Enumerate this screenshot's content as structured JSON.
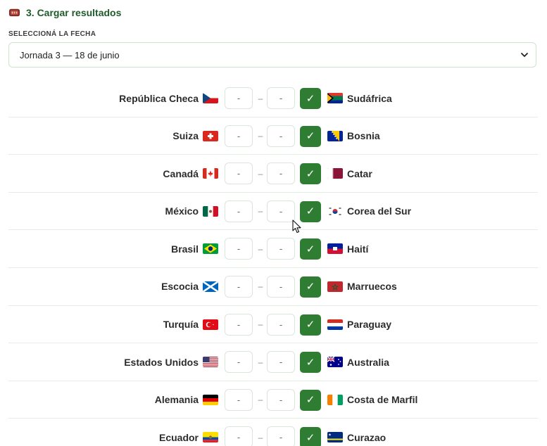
{
  "section": {
    "title": "3. Cargar resultados",
    "icon": "gamepad-icon"
  },
  "date_picker": {
    "label": "SELECCIONÁ LA FECHA",
    "selected": "Jornada 3 — 18 de junio"
  },
  "matches": [
    {
      "home": "República Checa",
      "home_flag": "cz",
      "away": "Sudáfrica",
      "away_flag": "za",
      "home_score": "-",
      "away_score": "-",
      "separator": "–"
    },
    {
      "home": "Suiza",
      "home_flag": "ch",
      "away": "Bosnia",
      "away_flag": "ba",
      "home_score": "-",
      "away_score": "-",
      "separator": "–"
    },
    {
      "home": "Canadá",
      "home_flag": "ca",
      "away": "Catar",
      "away_flag": "qa",
      "home_score": "-",
      "away_score": "-",
      "separator": "–"
    },
    {
      "home": "México",
      "home_flag": "mx",
      "away": "Corea del Sur",
      "away_flag": "kr",
      "home_score": "-",
      "away_score": "-",
      "separator": "–"
    },
    {
      "home": "Brasil",
      "home_flag": "br",
      "away": "Haití",
      "away_flag": "ht",
      "home_score": "-",
      "away_score": "-",
      "separator": "–"
    },
    {
      "home": "Escocia",
      "home_flag": "sco",
      "away": "Marruecos",
      "away_flag": "ma",
      "home_score": "-",
      "away_score": "-",
      "separator": "–"
    },
    {
      "home": "Turquía",
      "home_flag": "tr",
      "away": "Paraguay",
      "away_flag": "py",
      "home_score": "-",
      "away_score": "-",
      "separator": "–"
    },
    {
      "home": "Estados Unidos",
      "home_flag": "us",
      "away": "Australia",
      "away_flag": "au",
      "home_score": "-",
      "away_score": "-",
      "separator": "–"
    },
    {
      "home": "Alemania",
      "home_flag": "de",
      "away": "Costa de Marfil",
      "away_flag": "ci",
      "home_score": "-",
      "away_score": "-",
      "separator": "–"
    },
    {
      "home": "Ecuador",
      "home_flag": "ec",
      "away": "Curazao",
      "away_flag": "cw",
      "home_score": "-",
      "away_score": "-",
      "separator": "–"
    }
  ],
  "confirm_glyph": "✓",
  "colors": {
    "accent": "#2e7d32",
    "title": "#1f5b2a",
    "input_border": "#d9e6d9",
    "row_divider": "#e6ece6"
  }
}
